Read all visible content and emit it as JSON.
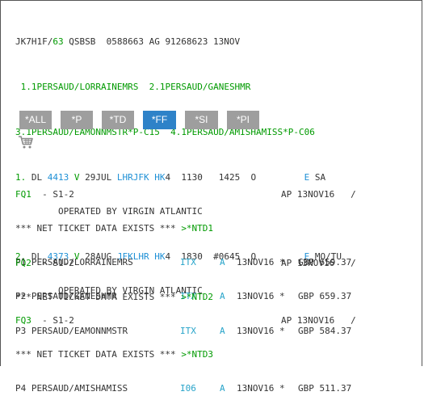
{
  "pnr": {
    "header": {
      "prefix": "JK7H1F/",
      "code": "63",
      "rest": " QSBSB  0588663 AG 91268623 13NOV"
    },
    "names": [
      {
        "num": " 1.1",
        "name": "PERSAUD/LORRAINEMRS"
      },
      {
        "num": "  2.1",
        "name": "PERSAUD/GANESHMR"
      },
      {
        "num": "3.1",
        "name": "PERSAUD/EAMONNMSTR*P-C15"
      },
      {
        "num": "  4.1",
        "name": "PERSAUD/AMISHAMISS*P-C06"
      }
    ],
    "segments": [
      {
        "idx": "1.",
        "airline": " DL ",
        "flight": "4413",
        "cls": " V",
        "date": " 29JUL ",
        "route": "LHRJFK",
        "status": " HK",
        "rest": "4  1130   1425  O         ",
        "e": "E",
        "days": " SA",
        "operated": "        OPERATED BY VIRGIN ATLANTIC"
      },
      {
        "idx": "2.",
        "airline": " DL ",
        "flight": "4373",
        "cls": " V",
        "date": " 28AUG ",
        "route": "JFKLHR",
        "status": " HK",
        "rest": "4  1830  #0645  O         ",
        "e": "E",
        "days": " MO/TU",
        "operated": "        OPERATED BY VIRGIN ATLANTIC"
      }
    ]
  },
  "toolbar": {
    "buttons": [
      {
        "label": "*ALL",
        "active": false
      },
      {
        "label": "*P",
        "active": false
      },
      {
        "label": "*TD",
        "active": false
      },
      {
        "label": "*FF",
        "active": true
      },
      {
        "label": "*SI",
        "active": false
      },
      {
        "label": "*PI",
        "active": false
      }
    ],
    "cart_icon": "shopping-cart-icon"
  },
  "fares": [
    {
      "id": "FQ1",
      "segments": "  - S1-2",
      "ap": "AP 13NOV16   /",
      "net_text": "*** NET TICKET DATA EXISTS *** ",
      "net_link": ">*NTD1",
      "passengers": [
        {
          "name": "P1 PERSAUD/LORRAINEMRS",
          "fare": "ITX",
          "a": "A",
          "date": "13NOV16 *",
          "amount": "GBP 659.37"
        },
        {
          "name": "P2 PERSAUD/GANESHMR",
          "fare": "ITX",
          "a": "A",
          "date": "13NOV16 *",
          "amount": "GBP 659.37"
        }
      ]
    },
    {
      "id": "FQ2",
      "segments": "  - S1-2",
      "ap": "AP 13NOV16   /",
      "net_text": "*** NET TICKET DATA EXISTS *** ",
      "net_link": ">*NTD2",
      "passengers": [
        {
          "name": "P3 PERSAUD/EAMONNMSTR",
          "fare": "ITX",
          "a": "A",
          "date": "13NOV16 *",
          "amount": "GBP 584.37"
        }
      ]
    },
    {
      "id": "FQ3",
      "segments": "  - S1-2",
      "ap": "AP 13NOV16   /",
      "net_text": "*** NET TICKET DATA EXISTS *** ",
      "net_link": ">*NTD3",
      "passengers": [
        {
          "name": "P4 PERSAUD/AMISHAMISS",
          "fare": "I06",
          "a": "A",
          "date": "13NOV16 *",
          "amount": "GBP 511.37"
        }
      ]
    }
  ]
}
